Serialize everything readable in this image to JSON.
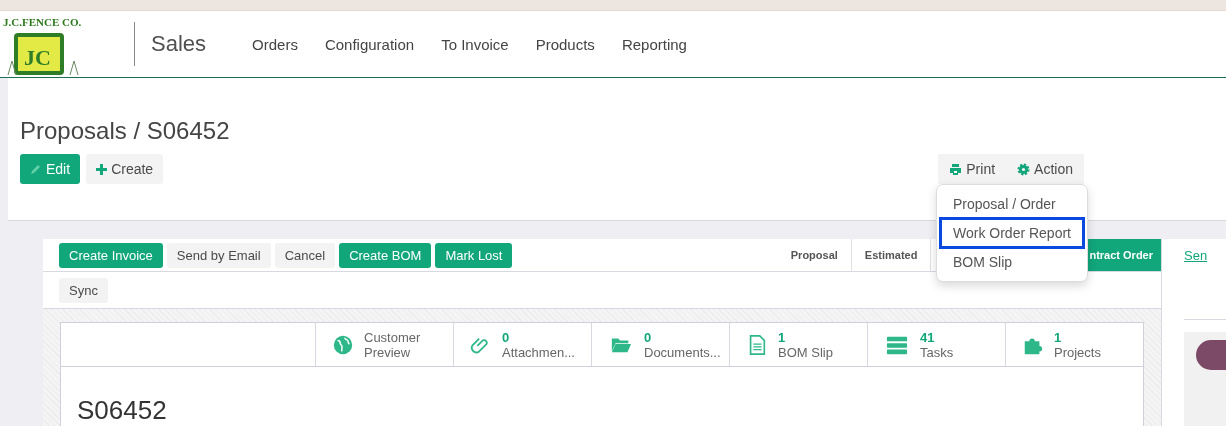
{
  "logo": {
    "name": "J.C.FENCE CO.",
    "monogram": "JC"
  },
  "navbar": {
    "app": "Sales",
    "menu": [
      "Orders",
      "Configuration",
      "To Invoice",
      "Products",
      "Reporting"
    ]
  },
  "breadcrumb": "Proposals / S06452",
  "main_buttons": [
    {
      "label": "Edit",
      "kind": "primary"
    },
    {
      "label": "Create",
      "kind": "secondary"
    }
  ],
  "sidebar_buttons": [
    {
      "label": "Print"
    },
    {
      "label": "Action"
    }
  ],
  "print_menu": [
    {
      "label": "Proposal / Order",
      "highlighted": false
    },
    {
      "label": "Work Order Report",
      "highlighted": true
    },
    {
      "label": "BOM Slip",
      "highlighted": false
    }
  ],
  "header_buttons": [
    {
      "label": "Create Invoice",
      "kind": "primary"
    },
    {
      "label": "Send by Email",
      "kind": "secondary"
    },
    {
      "label": "Cancel",
      "kind": "secondary"
    },
    {
      "label": "Create BOM",
      "kind": "primary"
    },
    {
      "label": "Mark Lost",
      "kind": "primary"
    }
  ],
  "header_buttons_row2": [
    {
      "label": "Sync"
    }
  ],
  "stages": [
    {
      "label": "Proposal",
      "selected": false
    },
    {
      "label": "Estimated",
      "selected": false
    },
    {
      "label": "ntract Order",
      "selected": true
    }
  ],
  "smart_buttons": [
    {
      "label": "Customer",
      "label2": "Preview"
    },
    {
      "count": "0",
      "label": "Attachmen..."
    },
    {
      "count": "0",
      "label": "Documents..."
    },
    {
      "count": "1",
      "label": "BOM Slip"
    },
    {
      "count": "41",
      "label": "Tasks"
    },
    {
      "count": "1",
      "label": "Projects"
    }
  ],
  "record_name": "S06452",
  "chatter": {
    "link": "Sen"
  }
}
